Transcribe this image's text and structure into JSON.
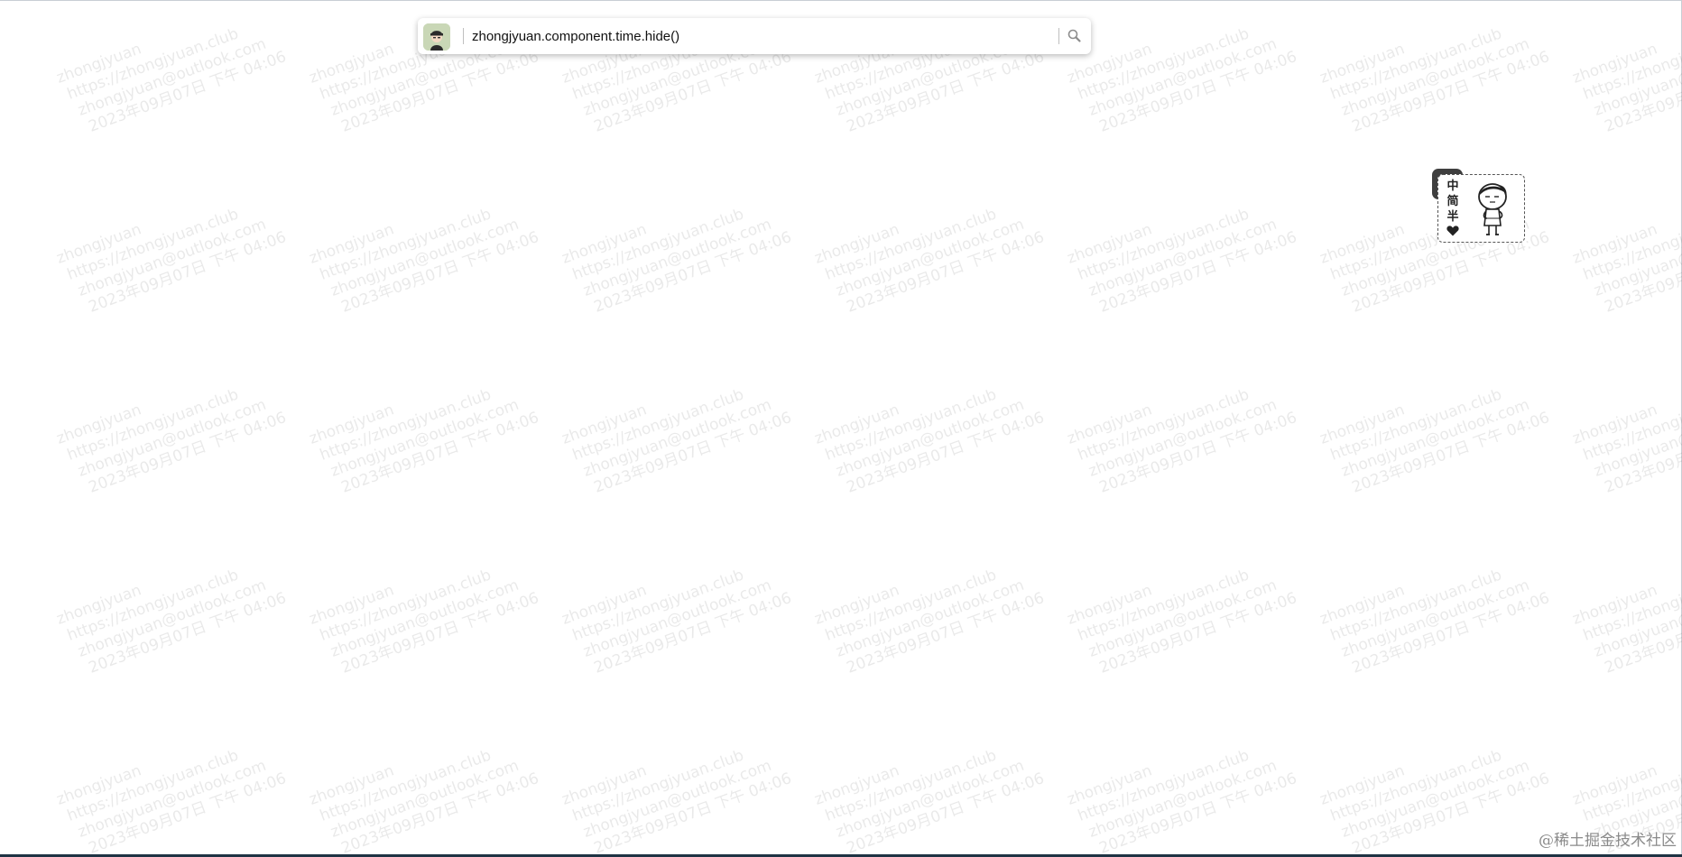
{
  "watermark": {
    "lines": [
      "zhongjyuan",
      "https://zhongjyuan.club",
      "zhongjyuan@outlook.com",
      "2023年09月07日 下午 04:06"
    ]
  },
  "search": {
    "value": "zhongjyuan.component.time.hide()",
    "avatar_icon": "user-avatar-icon",
    "button_icon": "magnifier-icon"
  },
  "mascot": {
    "labels": [
      "中",
      "简",
      "半"
    ],
    "heart_icon": "heart-icon",
    "figure_icon": "cartoon-person-icon"
  },
  "credit": {
    "text": "@稀土掘金技术社区"
  },
  "colors": {
    "accent_dark": "#3f3f3f",
    "avatar_bg": "#c9d7b6",
    "bottom_bar": "#1f3344"
  }
}
